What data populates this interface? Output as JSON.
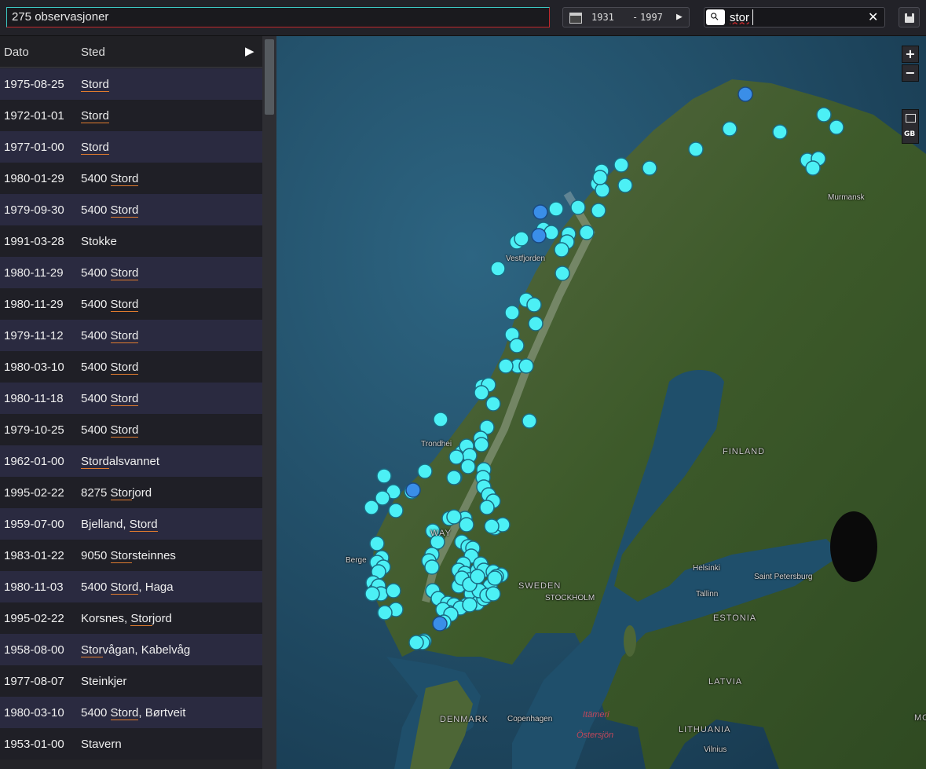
{
  "topbar": {
    "count_label": "275 observasjoner",
    "range_from": "1931",
    "range_dash": "-",
    "range_to": "1997",
    "search_value": "stor"
  },
  "list": {
    "header_date": "Dato",
    "header_place": "Sted",
    "rows": [
      {
        "date": "1975-08-25",
        "prefix": "",
        "match": "Stord",
        "suffix": ""
      },
      {
        "date": "1972-01-01",
        "prefix": "",
        "match": "Stord",
        "suffix": ""
      },
      {
        "date": "1977-01-00",
        "prefix": "",
        "match": "Stord",
        "suffix": ""
      },
      {
        "date": "1980-01-29",
        "prefix": "5400 ",
        "match": "Stord",
        "suffix": ""
      },
      {
        "date": "1979-09-30",
        "prefix": "5400 ",
        "match": "Stord",
        "suffix": ""
      },
      {
        "date": "1991-03-28",
        "prefix": "Stokke",
        "match": "",
        "suffix": ""
      },
      {
        "date": "1980-11-29",
        "prefix": "5400 ",
        "match": "Stord",
        "suffix": ""
      },
      {
        "date": "1980-11-29",
        "prefix": "5400 ",
        "match": "Stord",
        "suffix": ""
      },
      {
        "date": "1979-11-12",
        "prefix": "5400 ",
        "match": "Stord",
        "suffix": ""
      },
      {
        "date": "1980-03-10",
        "prefix": "5400 ",
        "match": "Stord",
        "suffix": ""
      },
      {
        "date": "1980-11-18",
        "prefix": "5400 ",
        "match": "Stord",
        "suffix": ""
      },
      {
        "date": "1979-10-25",
        "prefix": "5400 ",
        "match": "Stord",
        "suffix": ""
      },
      {
        "date": "1962-01-00",
        "prefix": "",
        "match": "Stord",
        "suffix": "alsvannet"
      },
      {
        "date": "1995-02-22",
        "prefix": "8275 ",
        "match": "Stor",
        "suffix": "jord"
      },
      {
        "date": "1959-07-00",
        "prefix": "Bjelland, ",
        "match": "Stord",
        "suffix": ""
      },
      {
        "date": "1983-01-22",
        "prefix": "9050 ",
        "match": "Stor",
        "suffix": "steinnes"
      },
      {
        "date": "1980-11-03",
        "prefix": "5400 ",
        "match": "Stord",
        "suffix": ", Haga"
      },
      {
        "date": "1995-02-22",
        "prefix": "Korsnes, ",
        "match": "Stor",
        "suffix": "jord"
      },
      {
        "date": "1958-08-00",
        "prefix": "",
        "match": "Stor",
        "suffix": "vågan, Kabelvåg"
      },
      {
        "date": "1977-08-07",
        "prefix": "Steinkjer",
        "match": "",
        "suffix": ""
      },
      {
        "date": "1980-03-10",
        "prefix": "5400 ",
        "match": "Stord",
        "suffix": ", Børtveit"
      },
      {
        "date": "1953-01-00",
        "prefix": "Stavern",
        "match": "",
        "suffix": ""
      }
    ]
  },
  "map": {
    "zoom_in": "+",
    "zoom_out": "−",
    "layer_label": "GB",
    "labels": {
      "murmansk": "Murmansk",
      "vestfjorden": "Vestfjorden",
      "trondheim": "Trondhei",
      "finland": "FINLAND",
      "norway": "WAY",
      "bergen": "Berge",
      "helsinki": "Helsinki",
      "saint_petersburg": "Saint Petersburg",
      "sweden": "SWEDEN",
      "stockholm": "STOCKHOLM",
      "tallinn": "Tallinn",
      "estonia": "ESTONIA",
      "latvia": "LATVIA",
      "lithuania": "LITHUANIA",
      "vilnius": "Vilnius",
      "denmark": "DENMARK",
      "copenhagen": "Copenhagen",
      "mos": "MOS",
      "baltic_1": "Itämeri",
      "baltic_2": "Östersjön"
    },
    "colors": {
      "marker": "#4cf0f5",
      "marker_dark": "#3a8ee8",
      "sea": "#1e4c66",
      "land": "#3f5a2c"
    }
  }
}
